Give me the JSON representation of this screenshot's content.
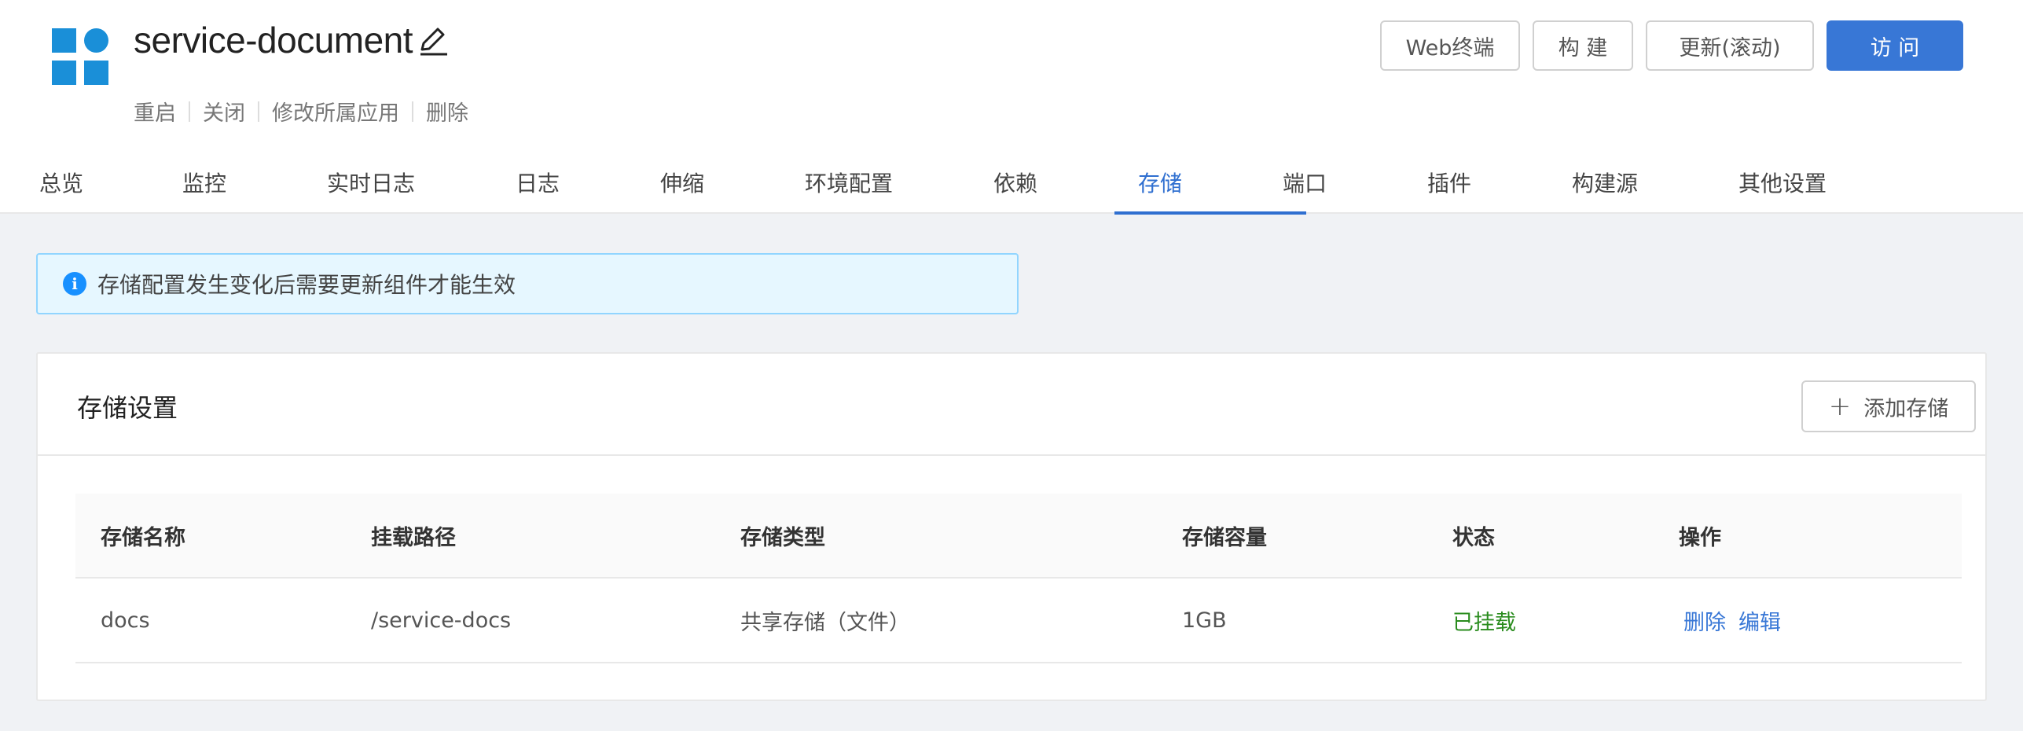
{
  "header": {
    "title": "service-document",
    "sub_actions": [
      "重启",
      "关闭",
      "修改所属应用",
      "删除"
    ],
    "buttons": {
      "web_terminal": "Web终端",
      "build": "构 建",
      "update": "更新(滚动)",
      "visit": "访 问"
    }
  },
  "tabs": [
    "总览",
    "监控",
    "实时日志",
    "日志",
    "伸缩",
    "环境配置",
    "依赖",
    "存储",
    "端口",
    "插件",
    "构建源",
    "其他设置"
  ],
  "active_tab": "存储",
  "alert": {
    "text": "存储配置发生变化后需要更新组件才能生效"
  },
  "storage": {
    "title": "存储设置",
    "add_button": "添加存储",
    "columns": [
      "存储名称",
      "挂载路径",
      "存储类型",
      "存储容量",
      "状态",
      "操作"
    ],
    "rows": [
      {
        "name": "docs",
        "path": "/service-docs",
        "type": "共享存储（文件）",
        "capacity": "1GB",
        "status": "已挂载",
        "actions": [
          "删除",
          "编辑"
        ]
      }
    ]
  },
  "colors": {
    "primary": "#3877d6",
    "logo": "#1a8fd8",
    "status_ok": "#2a8c1e",
    "alert_bg": "#e6f7ff"
  }
}
